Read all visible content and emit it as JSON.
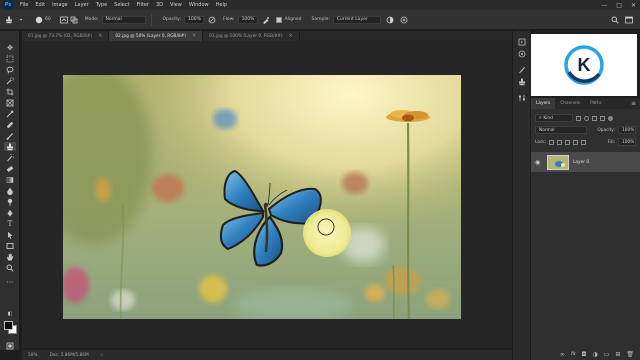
{
  "app": {
    "logo_text": "Ps"
  },
  "menu": [
    "File",
    "Edit",
    "Image",
    "Layer",
    "Type",
    "Select",
    "Filter",
    "3D",
    "View",
    "Window",
    "Help"
  ],
  "window_controls": [
    "—",
    "□",
    "✕"
  ],
  "options": {
    "brush_size": "60",
    "mode_label": "Mode:",
    "mode_value": "Normal",
    "opacity_label": "Opacity:",
    "opacity_value": "100%",
    "flow_label": "Flow:",
    "flow_value": "100%",
    "aligned_label": "Aligned",
    "sample_label": "Sample:",
    "sample_value": "Current Layer"
  },
  "tabs": [
    {
      "label": "01.jpg @ 73.7% (02, RGB/8#)",
      "active": false
    },
    {
      "label": "02.jpg @ 50% (Layer 0, RGB/8#)",
      "active": true
    },
    {
      "label": "03.jpg @ 100% (Layer 0, RGB/8#)",
      "active": false
    }
  ],
  "status": {
    "zoom": "50%",
    "doc": "Doc: 5.86M/5.86M"
  },
  "panel": {
    "tabs": [
      "Layers",
      "Channels",
      "Paths"
    ],
    "kind_label": "Kind",
    "blend_mode": "Normal",
    "opacity_label": "Opacity:",
    "opacity_value": "100%",
    "lock_label": "Lock:",
    "fill_label": "Fill:",
    "fill_value": "100%",
    "layer_name": "Layer 0",
    "footer_icons": [
      "link-icon",
      "fx-icon",
      "mask-icon",
      "adjustment-icon",
      "folder-icon",
      "new-layer-icon",
      "trash-icon"
    ]
  },
  "colors": {
    "accent": "#31a8ff",
    "foreground": "#0a0a0a",
    "background": "#ffffff",
    "butterfly_blue": "#3b8cc9",
    "brush_cursor": "#f7f5a3"
  },
  "logo": {
    "letter": "K"
  }
}
